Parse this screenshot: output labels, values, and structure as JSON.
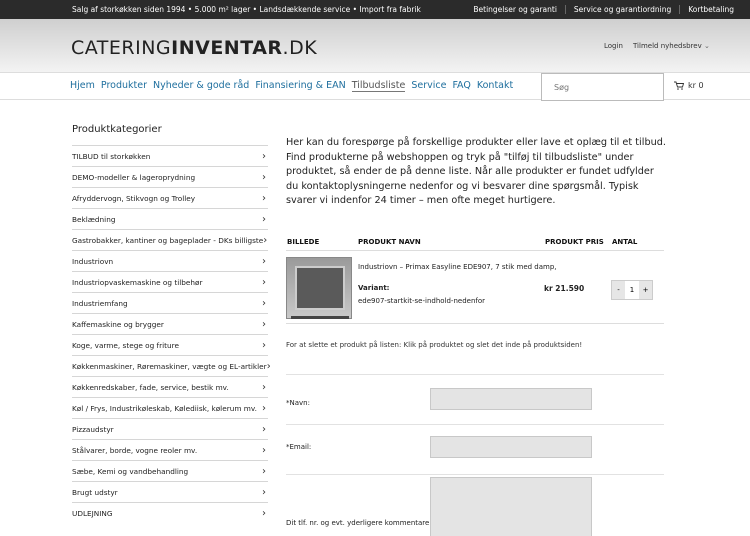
{
  "topbar": {
    "promo": "Salg af storkøkken siden 1994 • 5.000 m² lager • Landsdækkende service • Import fra fabrik",
    "links": [
      "Betingelser og garanti",
      "Service og garantiordning",
      "Kortbetaling"
    ]
  },
  "header": {
    "logo_part1": "CATERING",
    "logo_part2": "INVENTAR",
    "logo_part3": ".DK",
    "login": "Login",
    "newsletter": "Tilmeld nyhedsbrev"
  },
  "nav": {
    "items": [
      "Hjem",
      "Produkter",
      "Nyheder & gode råd",
      "Finansiering & EAN",
      "Tilbudsliste",
      "Service",
      "FAQ",
      "Kontakt"
    ],
    "search_placeholder": "Søg",
    "cart": "kr 0"
  },
  "sidebar": {
    "title": "Produktkategorier",
    "categories": [
      "TILBUD til storkøkken",
      "DEMO-modeller & lageroprydning",
      "Afryddervogn, Stikvogn og Trolley",
      "Beklædning",
      "Gastrobakker, kantiner og bageplader - DKs billigste",
      "Industriovn",
      "Industriopvaskemaskine og tilbehør",
      "Industriemfang",
      "Kaffemaskine og brygger",
      "Koge, varme, stege og friture",
      "Køkkenmaskiner, Røremaskiner, vægte og EL-artikler",
      "Køkkenredskaber, fade, service, bestik mv.",
      "Køl / Frys, Industrikøleskab, Kølediisk, kølerum mv.",
      "Pizzaudstyr",
      "Stålvarer, borde, vogne reoler mv.",
      "Sæbe, Kemi og vandbehandling",
      "Brugt udstyr",
      "UDLEJNING"
    ]
  },
  "main": {
    "intro": "Her kan du forespørge på forskellige produkter eller lave et oplæg til et tilbud. Find produkterne på webshoppen og tryk på \"tilføj til tilbudsliste\" under produktet, så ender de på denne liste. Når alle produkter er fundet udfylder du kontaktoplysningerne nedenfor og vi besvarer dine spørgsmål. Typisk svarer vi indenfor 24 timer – men ofte meget hurtigere.",
    "table_headers": {
      "image": "BILLEDE",
      "name": "PRODUKT NAVN",
      "price": "PRODUKT PRIS",
      "qty": "ANTAL"
    },
    "product": {
      "name": "Industriovn – Primax Easyline EDE907, 7 stik med damp,",
      "variant_label": "Variant:",
      "variant": "ede907-startkit-se-indhold-nedenfor",
      "price": "kr 21.590",
      "qty_minus": "-",
      "qty": "1",
      "qty_plus": "+"
    },
    "note": "For at slette et produkt på listen: Klik på produktet og slet det inde på produktsiden!",
    "form": {
      "name_label": "*Navn:",
      "email_label": "*Email:",
      "comment_label": "Dit tlf. nr. og evt. yderligere kommentarer::"
    }
  }
}
